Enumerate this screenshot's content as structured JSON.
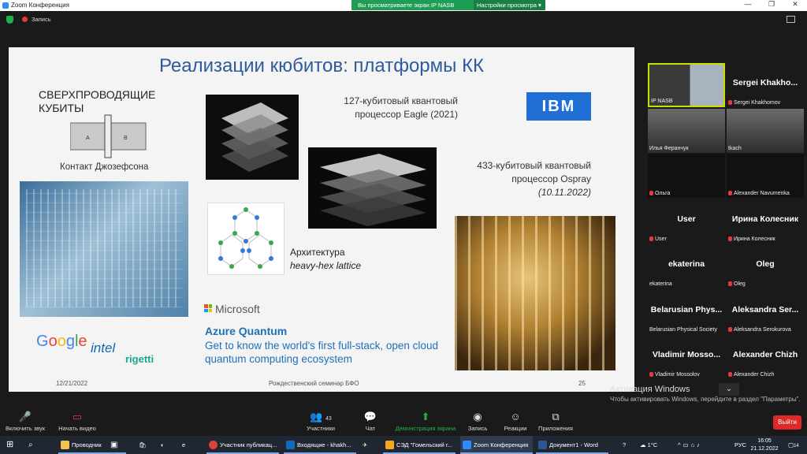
{
  "window": {
    "title": "Zoom Конференция",
    "share_banner": "Вы просматриваете экран IP NASB",
    "view_options": "Настройки просмотра",
    "recording": "Запись"
  },
  "slide": {
    "title": "Реализации кюбитов: платформы КК",
    "superconducting_title": "СВЕРХПРОВОДЯЩИЕ КУБИТЫ",
    "josephson_label": "Контакт Джозефсона",
    "proc127_line1": "127-кубитовый квантовый",
    "proc127_line2": "процессор Eagle (2021)",
    "proc433_line1": "433-кубитовый квантовый",
    "proc433_line2": "процессор Ospray",
    "proc433_line3": "(10.11.2022)",
    "arch_line1": "Архитектура",
    "arch_line2": "heavy-hex lattice",
    "ibm": "IBM",
    "microsoft": "Microsoft",
    "azure_title": "Azure Quantum",
    "azure_desc": "Get to know the world's first full-stack, open cloud quantum computing ecosystem",
    "google": "Google",
    "intel": "intel",
    "rigetti": "rigetti",
    "date": "12/21/2022",
    "footer": "Рождественский семинар БФО",
    "page": "25"
  },
  "participants": [
    {
      "big": "",
      "small": "IP NASB",
      "kind": "video-active",
      "muted": false
    },
    {
      "big": "Sergei Khakho...",
      "small": "Sergei Khakhomov",
      "kind": "name",
      "muted": true
    },
    {
      "big": "",
      "small": "Илья Феранчук",
      "kind": "video",
      "muted": false
    },
    {
      "big": "",
      "small": "tkach",
      "kind": "video",
      "muted": false
    },
    {
      "big": "",
      "small": "Ольга",
      "kind": "video-dark",
      "muted": true
    },
    {
      "big": "",
      "small": "Alexander Navumenka",
      "kind": "video-dark",
      "muted": true
    },
    {
      "big": "User",
      "small": "User",
      "kind": "name",
      "muted": true
    },
    {
      "big": "Ирина Колесник",
      "small": "Ирина Колесник",
      "kind": "name",
      "muted": true
    },
    {
      "big": "ekaterina",
      "small": "ekaterina",
      "kind": "name",
      "muted": false
    },
    {
      "big": "Oleg",
      "small": "Oleg",
      "kind": "name",
      "muted": true
    },
    {
      "big": "Belarusian Phys...",
      "small": "Belarusian Physical Society",
      "kind": "name",
      "muted": false
    },
    {
      "big": "Aleksandra Ser...",
      "small": "Aleksandra Serokurova",
      "kind": "name",
      "muted": true
    },
    {
      "big": "Vladimir Mosso...",
      "small": "Vladimir Mossolov",
      "kind": "name",
      "muted": true
    },
    {
      "big": "Alexander Chizh",
      "small": "Alexander Chizh",
      "kind": "name",
      "muted": true
    }
  ],
  "activation": {
    "title": "Активация Windows",
    "sub": "Чтобы активировать Windows, перейдите в раздел \"Параметры\"."
  },
  "toolbar": {
    "mute": "Включить звук",
    "video": "Начать видео",
    "participants": "Участники",
    "participants_count": "43",
    "chat": "Чат",
    "share": "Демонстрация экрана",
    "record": "Запись",
    "reactions": "Реакции",
    "apps": "Приложения",
    "leave": "Выйти"
  },
  "taskbar": {
    "explorer": "Проводник",
    "chrome": "Участник публикац...",
    "outlook": "Входящие - khakh...",
    "sed": "СЭД \"Гомельский г...",
    "zoom": "Zoom Конференция",
    "word": "Документ1 - Word",
    "temp": "1°C",
    "lang": "РУС",
    "time": "16:05",
    "date": "21.12.2022",
    "notif": "14"
  },
  "colors": {
    "accent": "#2e5b9b",
    "share_green": "#1f9d55",
    "leave_red": "#e02828",
    "active_border": "#c8e000"
  }
}
